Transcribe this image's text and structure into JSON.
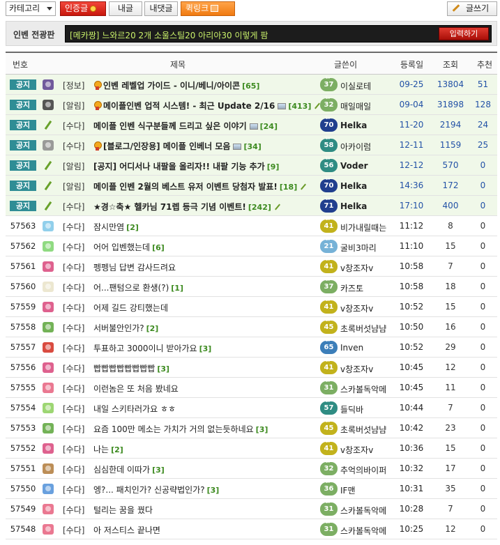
{
  "toolbar": {
    "category_label": "카테고리",
    "cert_label": "인증글",
    "mine_label": "내글",
    "my_comments_label": "내댓글",
    "quicklink_label": "퀵링크",
    "write_label": "글쓰기"
  },
  "bulletin": {
    "label": "인벤 전광판",
    "prefix": "[메카짱]",
    "message": "느와르20 2개 소울스틸20 아리아30 이렇게 팜",
    "submit_label": "입력하기"
  },
  "table_headers": {
    "num": "번호",
    "title": "제목",
    "author": "글쓴이",
    "date": "등록일",
    "views": "조회",
    "recommend": "추천"
  },
  "notice_badge": "공지",
  "rows": [
    {
      "notice": true,
      "num": "",
      "cat": "[정보]",
      "title": "인벤 레벨업 가이드 - 이니/베니/아이콘",
      "comments": "[65]",
      "ribbon": true,
      "img": false,
      "pen": false,
      "lv": "37",
      "lvc": "g",
      "author": "이실로테",
      "bold": false,
      "date": "09-25",
      "views": "13804",
      "rec": "51",
      "icon": "avatar-icon",
      "icolor": "#5a3e8e"
    },
    {
      "notice": true,
      "num": "",
      "cat": "[알림]",
      "title": "메이플인벤 업적 시스템! - 최근 Update 2/16",
      "comments": "[413]",
      "ribbon": true,
      "img": true,
      "pen": true,
      "lv": "32",
      "lvc": "g",
      "author": "매일매일",
      "bold": false,
      "date": "09-04",
      "views": "31898",
      "rec": "128",
      "icon": "card-icon",
      "icolor": "#3a3a3a"
    },
    {
      "notice": true,
      "num": "",
      "cat": "[수다]",
      "title": "메이플 인벤 식구분들께 드리고 싶은 이야기",
      "comments": "[24]",
      "ribbon": false,
      "img": true,
      "pen": false,
      "lv": "70",
      "lvc": "n",
      "author": "Helka",
      "bold": true,
      "date": "11-20",
      "views": "2194",
      "rec": "24",
      "icon": "pencil-icon",
      "icolor": ""
    },
    {
      "notice": true,
      "num": "",
      "cat": "[수다]",
      "title": "[블로그/인장용] 메이플 인베너 모음",
      "comments": "[34]",
      "ribbon": true,
      "img": true,
      "pen": false,
      "lv": "58",
      "lvc": "t",
      "author": "아카이럼",
      "bold": false,
      "date": "12-11",
      "views": "1159",
      "rec": "25",
      "icon": "medal-icon",
      "icolor": "#8a8a8a"
    },
    {
      "notice": true,
      "num": "",
      "cat": "[알림]",
      "title": "[공지] 어디서나 내팔을 올리자!! 내팔 기능 추가",
      "comments": "[9]",
      "ribbon": false,
      "img": false,
      "pen": false,
      "lv": "56",
      "lvc": "t",
      "author": "Voder",
      "bold": true,
      "date": "12-12",
      "views": "570",
      "rec": "0",
      "icon": "pencil-icon",
      "icolor": ""
    },
    {
      "notice": true,
      "num": "",
      "cat": "[알림]",
      "title": "메이플 인벤 2월의 베스트 유저 이벤트 당첨자 발표!",
      "comments": "[18]",
      "ribbon": false,
      "img": false,
      "pen": true,
      "lv": "70",
      "lvc": "n",
      "author": "Helka",
      "bold": true,
      "date": "14:36",
      "views": "172",
      "rec": "0",
      "icon": "pencil-icon",
      "icolor": ""
    },
    {
      "notice": true,
      "num": "",
      "cat": "[수다]",
      "title": "★경☆축★ 헬카님 71렙 등극 기념 이벤트!",
      "comments": "[242]",
      "ribbon": false,
      "img": false,
      "pen": true,
      "lv": "71",
      "lvc": "n",
      "author": "Helka",
      "bold": true,
      "date": "17:10",
      "views": "400",
      "rec": "0",
      "icon": "pencil-icon",
      "icolor": ""
    },
    {
      "notice": false,
      "num": "57563",
      "cat": "[수다]",
      "title": "잠시만염",
      "comments": "[2]",
      "ribbon": false,
      "img": false,
      "pen": false,
      "lv": "41",
      "lvc": "y",
      "author": "비가내릴때는",
      "bold": false,
      "date": "11:12",
      "views": "8",
      "rec": "0",
      "icon": "landscape-icon",
      "icolor": "#7ec7e8"
    },
    {
      "notice": false,
      "num": "57562",
      "cat": "[수다]",
      "title": "어어 입벤했는데",
      "comments": "[6]",
      "ribbon": false,
      "img": false,
      "pen": false,
      "lv": "21",
      "lvc": "lb",
      "author": "굴비3마리",
      "bold": false,
      "date": "11:10",
      "views": "15",
      "rec": "0",
      "icon": "heart-icon",
      "icolor": "#7bd36b"
    },
    {
      "notice": false,
      "num": "57561",
      "cat": "[수다]",
      "title": "펭펭님 답변 감사드려요",
      "comments": "",
      "ribbon": false,
      "img": false,
      "pen": false,
      "lv": "41",
      "lvc": "y",
      "author": "v창조자v",
      "bold": false,
      "date": "10:58",
      "views": "7",
      "rec": "0",
      "icon": "character-icon",
      "icolor": "#d8457a"
    },
    {
      "notice": false,
      "num": "57560",
      "cat": "[수다]",
      "title": "어...팬텀으로 환생(?)",
      "comments": "[1]",
      "ribbon": false,
      "img": false,
      "pen": false,
      "lv": "37",
      "lvc": "g",
      "author": "카즈토",
      "bold": false,
      "date": "10:58",
      "views": "18",
      "rec": "0",
      "icon": "fairy-icon",
      "icolor": "#e9e3c8"
    },
    {
      "notice": false,
      "num": "57559",
      "cat": "[수다]",
      "title": "어제 길드 강티했는데",
      "comments": "",
      "ribbon": false,
      "img": false,
      "pen": false,
      "lv": "41",
      "lvc": "y",
      "author": "v창조자v",
      "bold": false,
      "date": "10:52",
      "views": "15",
      "rec": "0",
      "icon": "character-icon",
      "icolor": "#d8457a"
    },
    {
      "notice": false,
      "num": "57558",
      "cat": "[수다]",
      "title": "서버불안인가?",
      "comments": "[2]",
      "ribbon": false,
      "img": false,
      "pen": false,
      "lv": "45",
      "lvc": "y",
      "author": "초록버섯냠냠",
      "bold": false,
      "date": "10:50",
      "views": "16",
      "rec": "0",
      "icon": "mushroom-icon",
      "icolor": "#5aa53a"
    },
    {
      "notice": false,
      "num": "57557",
      "cat": "[수다]",
      "title": "투표하고 3000이니 받아가요",
      "comments": "[3]",
      "ribbon": false,
      "img": false,
      "pen": false,
      "lv": "65",
      "lvc": "b",
      "author": "Inven",
      "bold": false,
      "date": "10:52",
      "views": "29",
      "rec": "0",
      "icon": "pokeball-icon",
      "icolor": "#d22b1f"
    },
    {
      "notice": false,
      "num": "57556",
      "cat": "[수다]",
      "title": "빱빱빱빱빱빱빱빱",
      "comments": "[3]",
      "ribbon": false,
      "img": false,
      "pen": false,
      "lv": "41",
      "lvc": "y",
      "author": "v창조자v",
      "bold": false,
      "date": "10:45",
      "views": "12",
      "rec": "0",
      "icon": "character-icon",
      "icolor": "#d8457a"
    },
    {
      "notice": false,
      "num": "57555",
      "cat": "[수다]",
      "title": "이런놈은 또 처음 봤네요",
      "comments": "",
      "ribbon": false,
      "img": false,
      "pen": false,
      "lv": "31",
      "lvc": "g",
      "author": "스카볼독악메",
      "bold": false,
      "date": "10:45",
      "views": "11",
      "rec": "0",
      "icon": "flower-icon",
      "icolor": "#e6607e"
    },
    {
      "notice": false,
      "num": "57554",
      "cat": "[수다]",
      "title": "내일 스키타러가요 ㅎㅎ",
      "comments": "",
      "ribbon": false,
      "img": false,
      "pen": false,
      "lv": "57",
      "lvc": "t",
      "author": "들딕바",
      "bold": false,
      "date": "10:44",
      "views": "7",
      "rec": "0",
      "icon": "leaf-icon",
      "icolor": "#8ccf5a"
    },
    {
      "notice": false,
      "num": "57553",
      "cat": "[수다]",
      "title": "요즘 100만 메소는 가치가 거의 없는듯하네요",
      "comments": "[3]",
      "ribbon": false,
      "img": false,
      "pen": false,
      "lv": "45",
      "lvc": "y",
      "author": "초록버섯냠냠",
      "bold": false,
      "date": "10:42",
      "views": "23",
      "rec": "0",
      "icon": "mushroom-icon",
      "icolor": "#5aa53a"
    },
    {
      "notice": false,
      "num": "57552",
      "cat": "[수다]",
      "title": "나는",
      "comments": "[2]",
      "ribbon": false,
      "img": false,
      "pen": false,
      "lv": "41",
      "lvc": "y",
      "author": "v창조자v",
      "bold": false,
      "date": "10:36",
      "views": "15",
      "rec": "0",
      "icon": "character-icon",
      "icolor": "#d8457a"
    },
    {
      "notice": false,
      "num": "57551",
      "cat": "[수다]",
      "title": "심심한데 이따가",
      "comments": "[3]",
      "ribbon": false,
      "img": false,
      "pen": false,
      "lv": "32",
      "lvc": "g",
      "author": "추억의바이퍼",
      "bold": false,
      "date": "10:32",
      "views": "17",
      "rec": "0",
      "icon": "monkey-icon",
      "icolor": "#b07a3a"
    },
    {
      "notice": false,
      "num": "57550",
      "cat": "[수다]",
      "title": "엥?... 패치인가? 신공략법인가?",
      "comments": "[3]",
      "ribbon": false,
      "img": false,
      "pen": false,
      "lv": "36",
      "lvc": "g",
      "author": "IF맨",
      "bold": false,
      "date": "10:31",
      "views": "35",
      "rec": "0",
      "icon": "blue-mushroom-icon",
      "icolor": "#4f8fd8"
    },
    {
      "notice": false,
      "num": "57549",
      "cat": "[수다]",
      "title": "털리는 꿈을 꿨다",
      "comments": "",
      "ribbon": false,
      "img": false,
      "pen": false,
      "lv": "31",
      "lvc": "g",
      "author": "스카볼독악메",
      "bold": false,
      "date": "10:28",
      "views": "7",
      "rec": "0",
      "icon": "flower-icon",
      "icolor": "#e6607e"
    },
    {
      "notice": false,
      "num": "57548",
      "cat": "[수다]",
      "title": "아 저스티스 끝나면",
      "comments": "",
      "ribbon": false,
      "img": false,
      "pen": false,
      "lv": "31",
      "lvc": "g",
      "author": "스카볼독악메",
      "bold": false,
      "date": "10:25",
      "views": "12",
      "rec": "0",
      "icon": "flower-icon",
      "icolor": "#e6607e"
    }
  ]
}
